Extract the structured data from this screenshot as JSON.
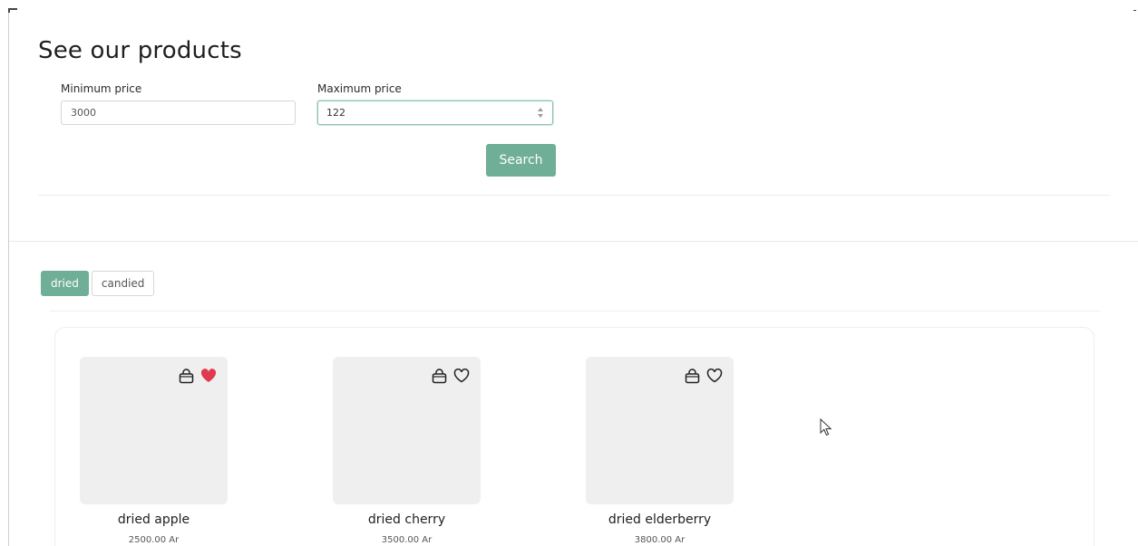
{
  "header": {
    "title": "See our products"
  },
  "filters": {
    "min_label": "Minimum price",
    "min_value": "3000",
    "max_label": "Maximum price",
    "max_value": "122",
    "search_label": "Search"
  },
  "tabs": [
    {
      "label": "dried",
      "active": true
    },
    {
      "label": "candied",
      "active": false
    }
  ],
  "products": [
    {
      "name": "dried apple",
      "price": "2500.00 Ar",
      "favorited": true
    },
    {
      "name": "dried cherry",
      "price": "3500.00 Ar",
      "favorited": false
    },
    {
      "name": "dried elderberry",
      "price": "3800.00 Ar",
      "favorited": false
    }
  ],
  "colors": {
    "accent": "#6fae97",
    "favorite": "#e03a50",
    "placeholder_bg": "#efefef"
  },
  "icons": {
    "cart": "shopping-bag-icon",
    "favorite": "heart-icon",
    "cursor": "mouse-pointer-icon",
    "spinner": "spinner-arrows-icon"
  }
}
